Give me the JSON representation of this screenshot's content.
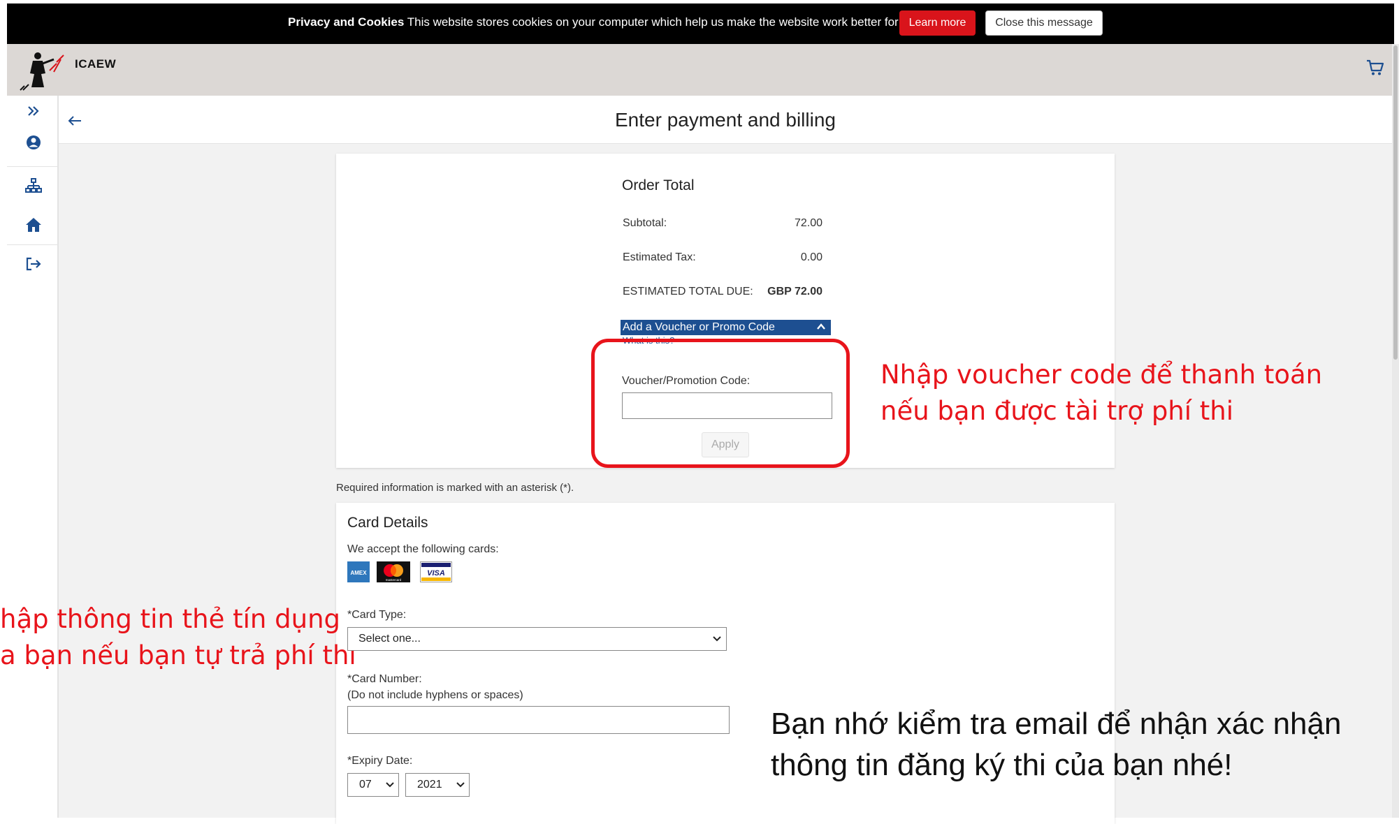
{
  "cookie_bar": {
    "title": "Privacy and Cookies",
    "message": "This website stores cookies on your computer which help us make the website work better for you.",
    "learn_more_label": "Learn more",
    "close_label": "Close this message"
  },
  "header": {
    "logo_text": "ICAEW",
    "cart_icon": "shopping-cart-icon"
  },
  "sidebar": {
    "icons": [
      "expand-icon",
      "user-icon",
      "sitemap-icon",
      "home-icon",
      "sign-out-icon"
    ]
  },
  "page": {
    "title": "Enter payment and billing"
  },
  "order": {
    "title": "Order Total",
    "subtotal_label": "Subtotal:",
    "subtotal_value": "72.00",
    "tax_label": "Estimated Tax:",
    "tax_value": "0.00",
    "total_label": "ESTIMATED TOTAL DUE:",
    "total_value": "GBP 72.00",
    "voucher_toggle_label": "Add a Voucher or Promo Code",
    "whats_this_label": "What is this?",
    "voucher_field_label": "Voucher/Promotion Code:",
    "voucher_value": "",
    "apply_label": "Apply"
  },
  "required_note": "Required information is marked with an asterisk (*).",
  "card": {
    "title": "Card Details",
    "accept_label": "We accept the following cards:",
    "logos": [
      "AMEX",
      "mastercard",
      "VISA"
    ],
    "type_label": "*Card Type:",
    "type_selected": "Select one...",
    "number_label": "*Card Number:",
    "number_hint": "(Do not include hyphens or spaces)",
    "number_value": "",
    "expiry_label": "*Expiry Date:",
    "expiry_month": "07",
    "expiry_year": "2021"
  },
  "annotations": {
    "voucher_line1": "Nhập voucher code để thanh toán",
    "voucher_line2": "nếu bạn được tài trợ phí thi",
    "card_line1": "hập thông tin thẻ tín dụng",
    "card_line2": "a bạn nếu bạn tự trả phí thi",
    "email_line1": "Bạn nhớ kiểm tra email để nhận xác nhận",
    "email_line2": "thông tin đăng ký thi của bạn nhé!"
  },
  "colors": {
    "accent_red": "#d9141b",
    "annotation_red": "#e8141b",
    "voucher_blue": "#1d4f91",
    "header_gray": "#dcd8d5",
    "icon_blue": "#1d4f91"
  }
}
